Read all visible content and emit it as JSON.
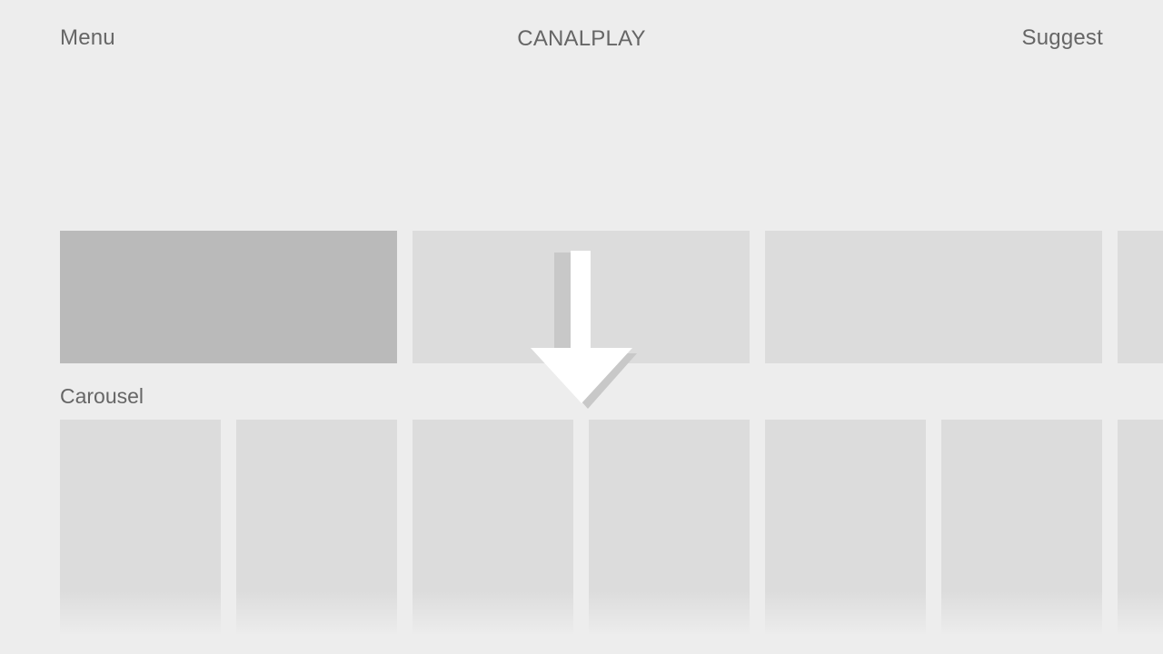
{
  "header": {
    "menu_label": "Menu",
    "brand_title": "CANALPLAY",
    "suggest_label": "Suggest"
  },
  "carousel": {
    "title": "Carousel"
  },
  "icons": {
    "scroll_indicator": "arrow-down-icon"
  },
  "colors": {
    "background": "#ededed",
    "tile": "#dcdcdc",
    "tile_focused": "#bababa",
    "text": "#666666",
    "arrow": "#ffffff"
  }
}
